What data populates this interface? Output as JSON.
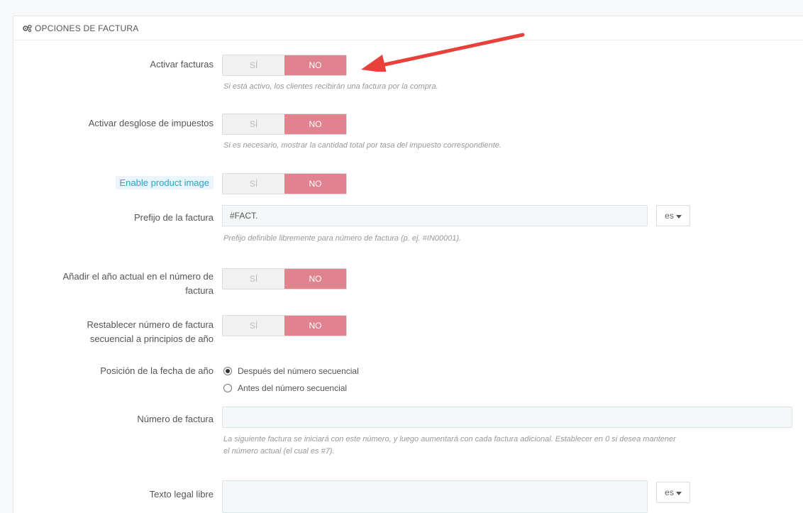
{
  "panel": {
    "title": "OPCIONES DE FACTURA"
  },
  "fields": {
    "activar_facturas": {
      "label": "Activar facturas",
      "yes": "SÍ",
      "no": "NO",
      "selected": "NO",
      "help": "Si está activo, los clientes recibirán una factura por la compra."
    },
    "desglose": {
      "label": "Activar desglose de impuestos",
      "yes": "SÍ",
      "no": "NO",
      "selected": "NO",
      "help": "Si es necesario, mostrar la cantidad total por tasa del impuesto correspondiente."
    },
    "product_image": {
      "label": "Enable product image",
      "yes": "SÍ",
      "no": "NO",
      "selected": "NO"
    },
    "prefijo": {
      "label": "Prefijo de la factura",
      "value": "#FACT.",
      "lang": "es",
      "help": "Prefijo definible libremente para número de factura (p. ej. #IN00001)."
    },
    "anio_numero": {
      "label_line1": "Añadir el año actual en el número de",
      "label_line2": "factura",
      "yes": "SÍ",
      "no": "NO",
      "selected": "NO"
    },
    "restablecer": {
      "label_line1": "Restablecer número de factura",
      "label_line2": "secuencial a principios de año",
      "yes": "SÍ",
      "no": "NO",
      "selected": "NO"
    },
    "posicion": {
      "label": "Posición de la fecha de año",
      "options": [
        "Después del número secuencial",
        "Antes del número secuencial"
      ],
      "selected_index": 0
    },
    "numero": {
      "label": "Número de factura",
      "value": "",
      "help_line1": "La siguiente factura se iniciará con este número, y luego aumentará con cada factura adicional. Establecer en 0 si desea mantener",
      "help_line2": "el número actual (el cual es #7)."
    },
    "texto_legal": {
      "label": "Texto legal libre",
      "value": "",
      "lang": "es"
    }
  },
  "annotation": {
    "arrow_color": "#e8403a"
  },
  "colors": {
    "switch_on": "#e0838e",
    "switch_off": "#f1f1f1",
    "highlight_label": "#2aa3c7"
  }
}
